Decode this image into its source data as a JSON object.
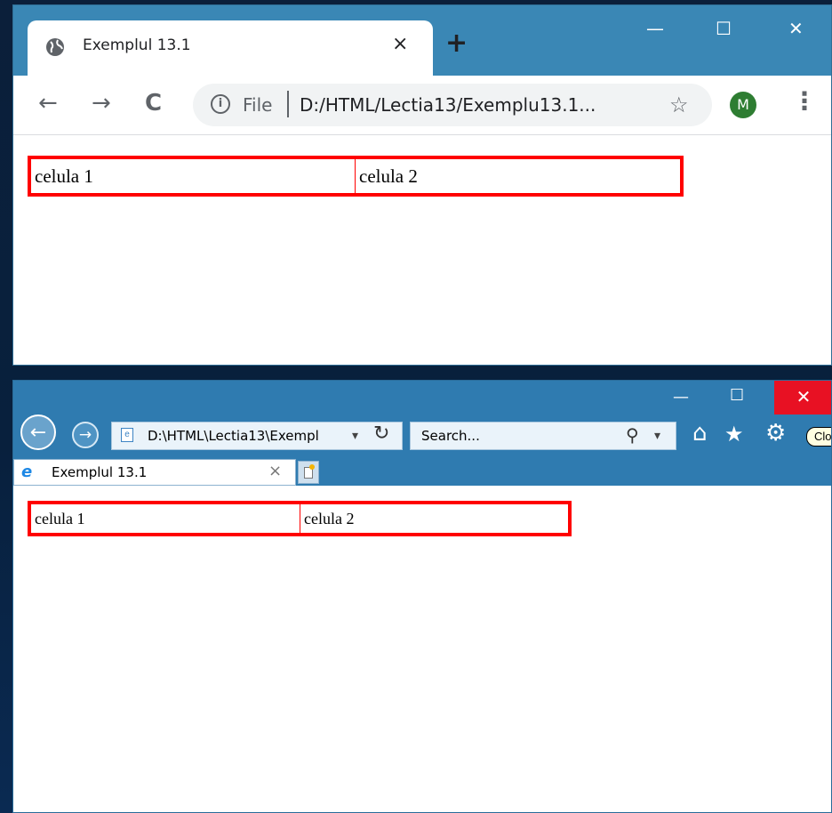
{
  "chrome": {
    "tab_title": "Exemplul 13.1",
    "tab_close": "×",
    "new_tab": "+",
    "minimize": "—",
    "maximize": "☐",
    "close": "✕",
    "back": "←",
    "forward": "→",
    "reload": "C",
    "address": {
      "info_icon": "i",
      "scheme_label": "File",
      "url": "D:/HTML/Lectia13/Exemplu13.1...",
      "star": "☆"
    },
    "avatar_initial": "M",
    "menu": "⋮",
    "table": {
      "cells": [
        "celula 1",
        "celula 2"
      ],
      "border_color": "#ff0000"
    }
  },
  "ie": {
    "minimize": "—",
    "maximize": "☐",
    "close": "✕",
    "back": "←",
    "forward": "→",
    "address_url": "D:\\HTML\\Lectia13\\Exempl",
    "address_dropdown": "▾",
    "refresh": "↻",
    "search_placeholder": "Search...",
    "search_icon": "⚲",
    "search_dropdown": "▾",
    "home": "⌂",
    "favorites": "★",
    "settings": "⚙",
    "tooltip": "Clo",
    "tab_title": "Exemplul 13.1",
    "tab_close": "×",
    "tab_icon": "e",
    "table": {
      "cells": [
        "celula 1",
        "celula 2"
      ],
      "border_color": "#ff0000"
    }
  },
  "colors": {
    "chrome_frame": "#3a87b5",
    "ie_frame": "#2f7bb0",
    "ie_close_bg": "#e81123",
    "avatar": "#2e7d32",
    "desktop": "#08203d"
  }
}
